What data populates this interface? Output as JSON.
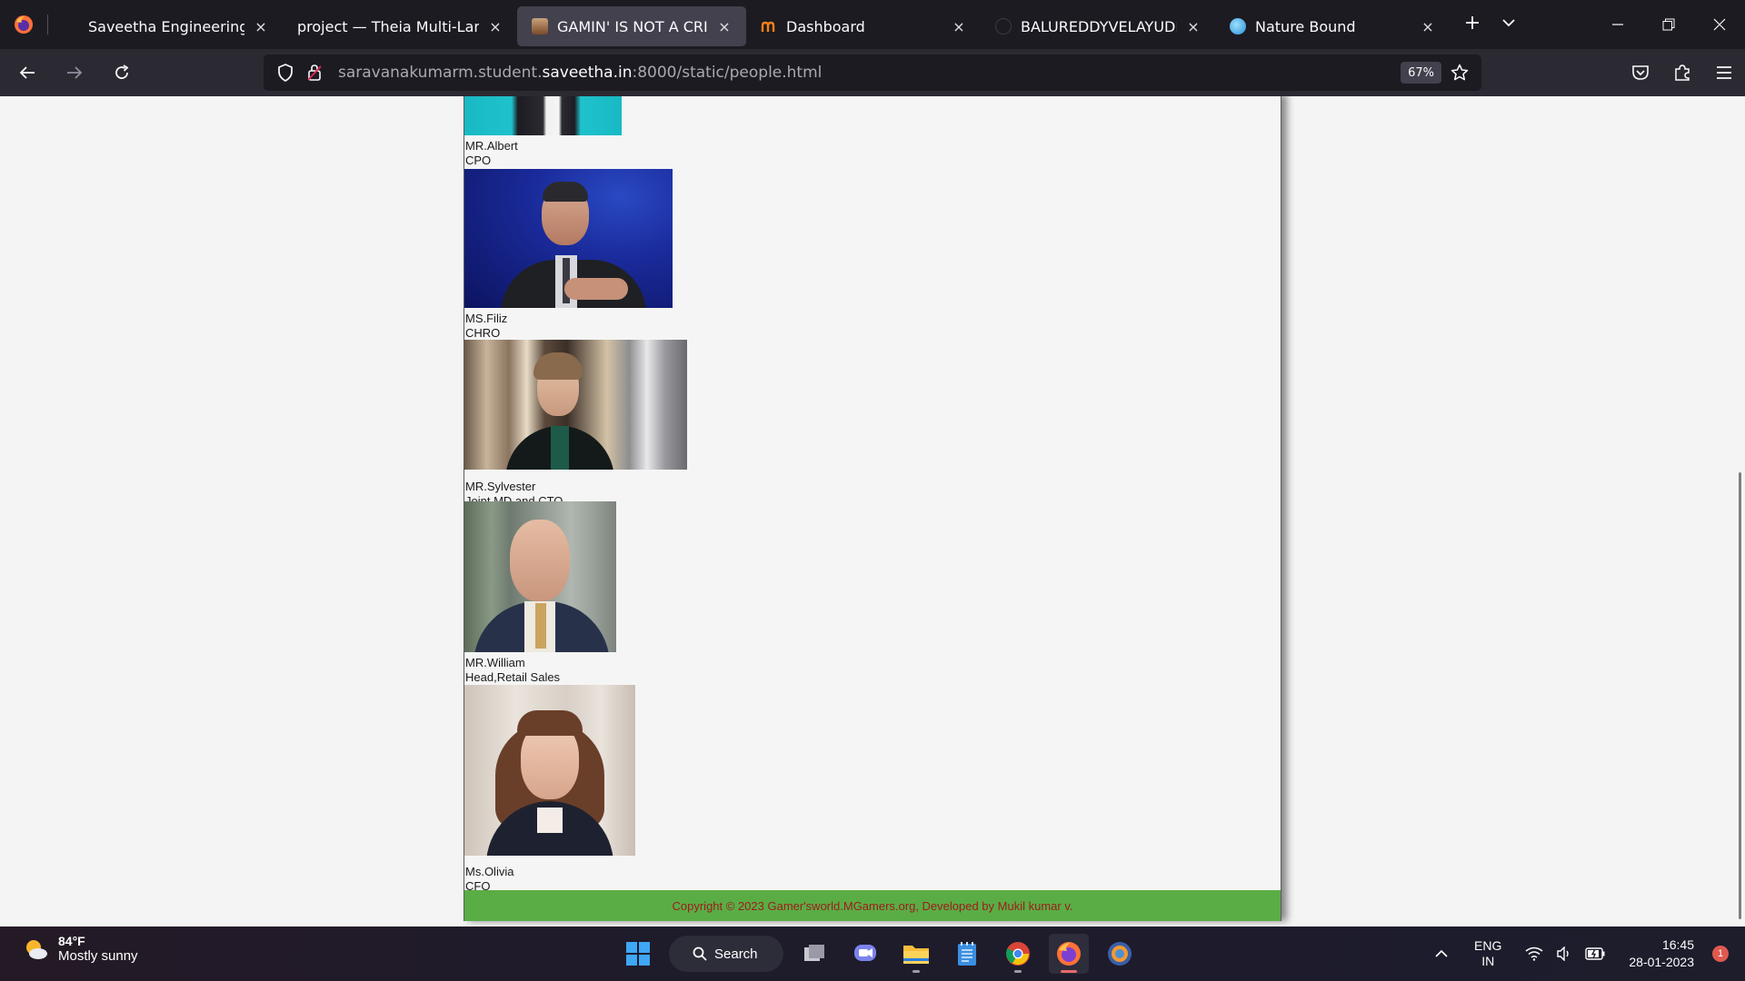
{
  "browser": {
    "tabs": [
      {
        "title": "Saveetha Engineering College",
        "favicon": "saveetha-favicon",
        "active": false
      },
      {
        "title": "project — Theia Multi-Language",
        "favicon": "theia-favicon",
        "active": false
      },
      {
        "title": "GAMIN' IS NOT A CRIME",
        "favicon": "game-favicon",
        "active": true
      },
      {
        "title": "Dashboard",
        "favicon": "moodle-favicon",
        "active": false
      },
      {
        "title": "BALUREDDYVELAYUDHAM",
        "favicon": "github-favicon",
        "active": false
      },
      {
        "title": "Nature Bound",
        "favicon": "globe-favicon",
        "active": false
      }
    ],
    "close_glyph": "×",
    "url_prefix": "saravanakumarm.student.",
    "url_host": "saveetha.in",
    "url_suffix": ":8000/static/people.html",
    "zoom": "67%"
  },
  "page": {
    "people": [
      {
        "name": "MR.Albert",
        "role": "CPO"
      },
      {
        "name": "MS.Filiz",
        "role": "CHRO"
      },
      {
        "name": "MR.Sylvester",
        "role": "Joint MD and CTO"
      },
      {
        "name": "MR.William",
        "role": "Head,Retail Sales"
      },
      {
        "name": "Ms.Olivia",
        "role": "CFO"
      }
    ],
    "footer": "Copyright © 2023 Gamer'sworld.MGamers.org, Developed by Mukil kumar v."
  },
  "taskbar": {
    "weather_temp": "84°F",
    "weather_condition": "Mostly sunny",
    "search_label": "Search",
    "lang_top": "ENG",
    "lang_bottom": "IN",
    "time": "16:45",
    "date": "28-01-2023",
    "notification_count": "1"
  }
}
